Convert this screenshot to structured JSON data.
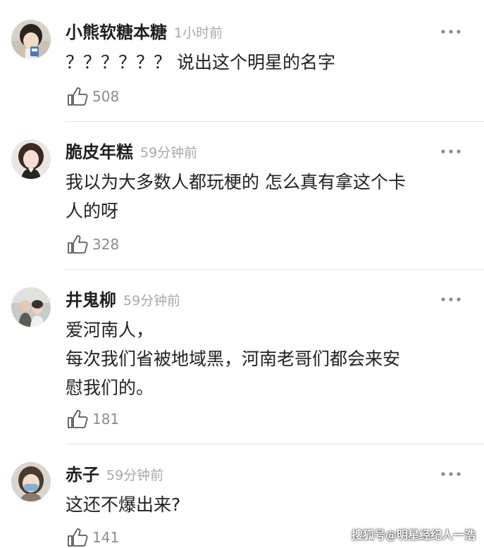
{
  "comments": [
    {
      "username": "小熊软糖本糖",
      "time": "1小时前",
      "lines": [
        "？？？？？？ 说出这个明星的名字"
      ],
      "likes": "508"
    },
    {
      "username": "脆皮年糕",
      "time": "59分钟前",
      "lines": [
        "我以为大多数人都玩梗的 怎么真有拿这个卡",
        "人的呀"
      ],
      "likes": "328"
    },
    {
      "username": "井鬼柳",
      "time": "59分钟前",
      "lines": [
        "爱河南人，",
        "每次我们省被地域黑，河南老哥们都会来安",
        "慰我们的。"
      ],
      "likes": "181"
    },
    {
      "username": "赤子",
      "time": "59分钟前",
      "lines": [
        "这还不爆出来?"
      ],
      "likes": "141"
    }
  ],
  "watermark": "搜狐号@明星经纪人一浩",
  "icons": {
    "like": "thumbs-up-icon",
    "more": "more-dots-icon"
  },
  "colors": {
    "username": "#1f1f1f",
    "timestamp": "#a8a8a8",
    "content": "#222222",
    "like_count": "#8c8c8c",
    "divider": "#e6e6e6"
  }
}
